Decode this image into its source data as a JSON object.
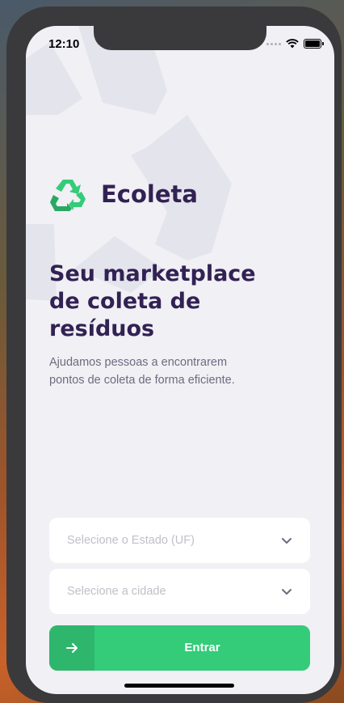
{
  "status_bar": {
    "time": "12:10"
  },
  "brand": {
    "name": "Ecoleta"
  },
  "hero": {
    "title_lines": [
      "Seu marketplace",
      "de coleta de",
      "resíduos"
    ],
    "description": "Ajudamos pessoas a encontrarem pontos de coleta de forma eficiente."
  },
  "form": {
    "state_placeholder": "Selecione o Estado (UF)",
    "city_placeholder": "Selecione a cidade",
    "submit_label": "Entrar"
  },
  "colors": {
    "primary": "#34cb79",
    "title": "#322153",
    "text": "#6c6c80",
    "background": "#f0f0f5"
  },
  "icons": {
    "logo": "recycle-icon",
    "select_arrow": "chevron-down-icon",
    "submit": "arrow-right-icon"
  }
}
